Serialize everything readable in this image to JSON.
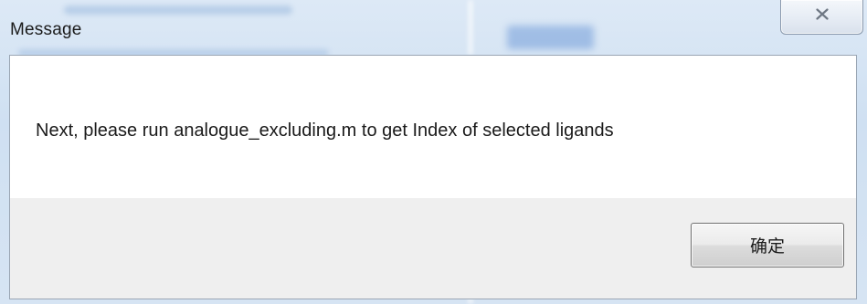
{
  "window": {
    "title": "Message",
    "close_glyph": "☒"
  },
  "dialog": {
    "message": "Next, please run analogue_excluding.m to get Index of selected ligands",
    "ok_label": "确定"
  },
  "icons": {
    "close": "close-icon"
  },
  "colors": {
    "frame": "#d6e4f3",
    "content_bg": "#ffffff",
    "footer_bg": "#efefef",
    "button_border": "#707070"
  }
}
